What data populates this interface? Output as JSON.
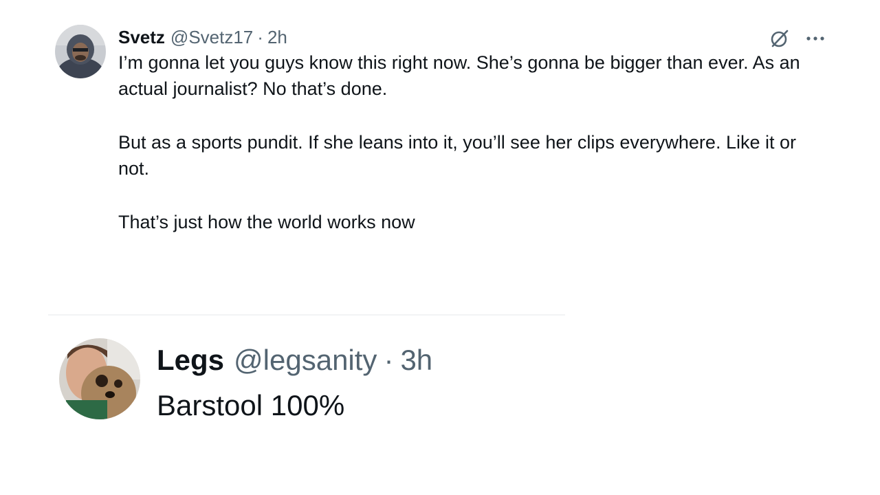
{
  "tweets": [
    {
      "author_name": "Svetz",
      "handle": "@Svetz17",
      "separator": "·",
      "time": "2h",
      "paragraphs": [
        "I’m gonna let you guys know this right now. She’s gonna be bigger than ever. As an actual journalist? No that’s done.",
        "But as a sports pundit. If she leans into it, you’ll see her clips everywhere. Like it or not.",
        "That’s just how the world works now"
      ],
      "icons": [
        "grok-icon",
        "more-icon"
      ]
    },
    {
      "author_name": "Legs",
      "handle": "@legsanity",
      "separator": "·",
      "time": "3h",
      "paragraphs": [
        "Barstool 100%"
      ]
    }
  ],
  "colors": {
    "text_primary": "#0f1419",
    "text_secondary": "#536471",
    "divider": "#f2f3f5"
  }
}
